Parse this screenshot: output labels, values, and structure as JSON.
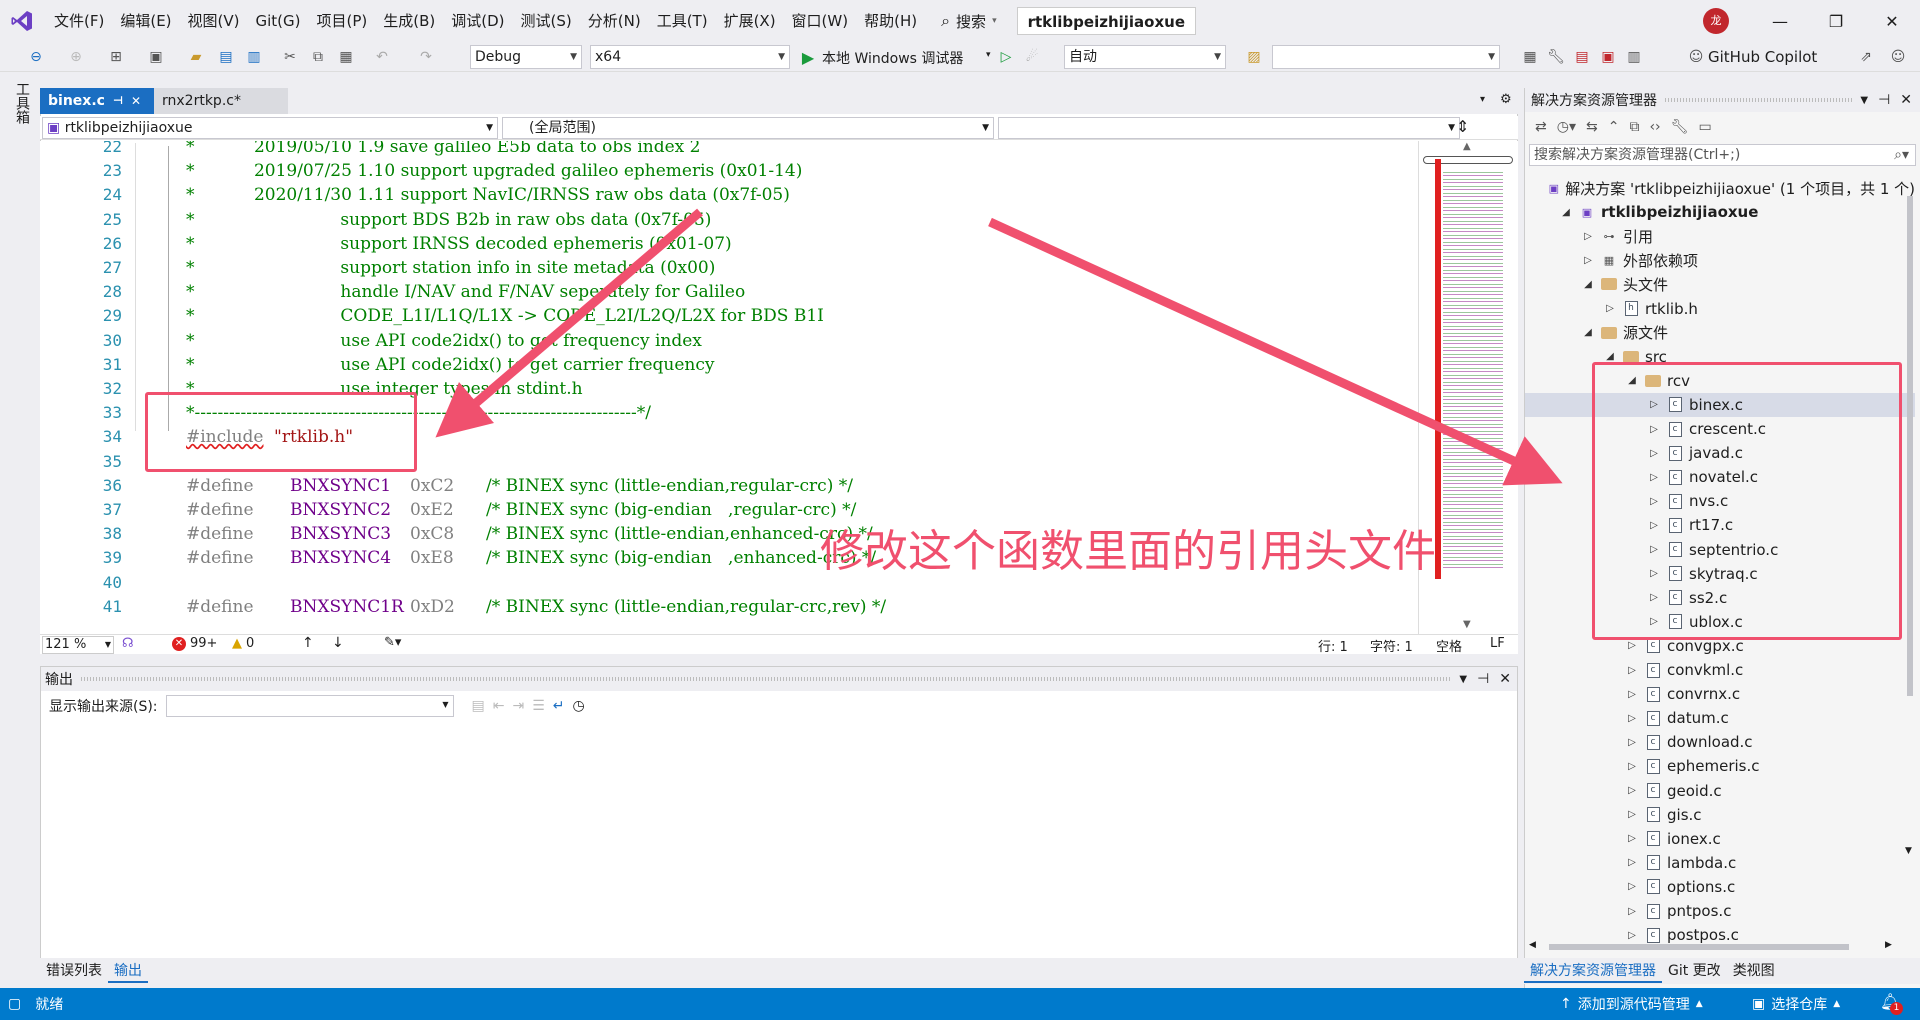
{
  "menubar": {
    "items": [
      "文件(F)",
      "编辑(E)",
      "视图(V)",
      "Git(G)",
      "项目(P)",
      "生成(B)",
      "调试(D)",
      "测试(S)",
      "分析(N)",
      "工具(T)",
      "扩展(X)",
      "窗口(W)",
      "帮助(H)"
    ],
    "search_label": "搜索",
    "solution_title": "rtklibpeizhijiaoxue",
    "avatar_text": "龙"
  },
  "toolbar": {
    "config": "Debug",
    "platform": "x64",
    "run_label": "本地 Windows 调试器",
    "auto_label": "自动",
    "copilot_label": "GitHub Copilot"
  },
  "left_strip": {
    "toolbox_label": "工具箱"
  },
  "editor": {
    "tabs": [
      {
        "label": "binex.c",
        "active": true
      },
      {
        "label": "rnx2rtkp.c*",
        "active": false
      }
    ],
    "nav": {
      "project": "rtklibpeizhijiaoxue",
      "scope": "(全局范围)",
      "member": ""
    },
    "lines": [
      {
        "num": "22",
        "text": "*           2019/05/10 1.9 save galileo E5b data to obs index 2"
      },
      {
        "num": "23",
        "text": "*           2019/07/25 1.10 support upgraded galileo ephemeris (0x01-14)"
      },
      {
        "num": "24",
        "text": "*           2020/11/30 1.11 support NavIC/IRNSS raw obs data (0x7f-05)"
      },
      {
        "num": "25",
        "text": "*                           support BDS B2b in raw obs data (0x7f-05)"
      },
      {
        "num": "26",
        "text": "*                           support IRNSS decoded ephemeris (0x01-07)"
      },
      {
        "num": "27",
        "text": "*                           support station info in site metadata (0x00)"
      },
      {
        "num": "28",
        "text": "*                           handle I/NAV and F/NAV seperately for Galileo"
      },
      {
        "num": "29",
        "text": "*                           CODE_L1I/L1Q/L1X -> CODE_L2I/L2Q/L2X for BDS B1I"
      },
      {
        "num": "30",
        "text": "*                           use API code2idx() to get frequency index"
      },
      {
        "num": "31",
        "text": "*                           use API code2idx() to get carrier frequency"
      },
      {
        "num": "32",
        "text": "*                           use integer types in stdint.h"
      },
      {
        "num": "33",
        "text": "*-----------------------------------------------------------------------------*/"
      },
      {
        "num": "34",
        "text": ""
      },
      {
        "num": "35",
        "text": ""
      },
      {
        "num": "36",
        "text": ""
      },
      {
        "num": "37",
        "text": ""
      },
      {
        "num": "38",
        "text": ""
      },
      {
        "num": "39",
        "text": ""
      },
      {
        "num": "40",
        "text": ""
      },
      {
        "num": "41",
        "text": ""
      }
    ],
    "include": {
      "directive": "#include",
      "file": "\"rtklib.h\""
    },
    "defines": [
      {
        "kw": "#define",
        "name": "BNXSYNC1",
        "val": "0xC2",
        "comment": "/* BINEX sync (little-endian,regular-crc) */"
      },
      {
        "kw": "#define",
        "name": "BNXSYNC2",
        "val": "0xE2",
        "comment": "/* BINEX sync (big-endian   ,regular-crc) */"
      },
      {
        "kw": "#define",
        "name": "BNXSYNC3",
        "val": "0xC8",
        "comment": "/* BINEX sync (little-endian,enhanced-crc) */"
      },
      {
        "kw": "#define",
        "name": "BNXSYNC4",
        "val": "0xE8",
        "comment": "/* BINEX sync (big-endian   ,enhanced-crc) */"
      },
      {
        "kw": "#define",
        "name": "BNXSYNC1R",
        "val": "0xD2",
        "comment": "/* BINEX sync (little-endian,regular-crc,rev) */"
      }
    ],
    "status": {
      "zoom": "121 %",
      "errors": "99+",
      "warnings": "0",
      "line": "行: 1",
      "col": "字符: 1",
      "ws": "空格",
      "eol": "LF"
    }
  },
  "output": {
    "title": "输出",
    "source_label": "显示输出来源(S):",
    "source_value": ""
  },
  "bottom_tabs": [
    "错误列表",
    "输出"
  ],
  "solution_explorer": {
    "title": "解决方案资源管理器",
    "search_placeholder": "搜索解决方案资源管理器(Ctrl+;)",
    "items": [
      {
        "label": "解决方案 'rtklibpeizhijiaoxue' (1 个项目，共 1 个)",
        "depth": 0,
        "kind": "solution",
        "exp": ""
      },
      {
        "label": "rtklibpeizhijiaoxue",
        "depth": 1,
        "kind": "project",
        "exp": "◢"
      },
      {
        "label": "引用",
        "depth": 2,
        "kind": "ref",
        "exp": "▷"
      },
      {
        "label": "外部依赖项",
        "depth": 2,
        "kind": "ext",
        "exp": "▷"
      },
      {
        "label": "头文件",
        "depth": 2,
        "kind": "folder",
        "exp": "◢"
      },
      {
        "label": "rtklib.h",
        "depth": 3,
        "kind": "h",
        "exp": "▷"
      },
      {
        "label": "源文件",
        "depth": 2,
        "kind": "folder",
        "exp": "◢"
      },
      {
        "label": "src",
        "depth": 3,
        "kind": "folder",
        "exp": "◢"
      },
      {
        "label": "rcv",
        "depth": 4,
        "kind": "folder",
        "exp": "◢"
      },
      {
        "label": "binex.c",
        "depth": 5,
        "kind": "c",
        "exp": "▷",
        "selected": true
      },
      {
        "label": "crescent.c",
        "depth": 5,
        "kind": "c",
        "exp": "▷"
      },
      {
        "label": "javad.c",
        "depth": 5,
        "kind": "c",
        "exp": "▷"
      },
      {
        "label": "novatel.c",
        "depth": 5,
        "kind": "c",
        "exp": "▷"
      },
      {
        "label": "nvs.c",
        "depth": 5,
        "kind": "c",
        "exp": "▷"
      },
      {
        "label": "rt17.c",
        "depth": 5,
        "kind": "c",
        "exp": "▷"
      },
      {
        "label": "septentrio.c",
        "depth": 5,
        "kind": "c",
        "exp": "▷"
      },
      {
        "label": "skytraq.c",
        "depth": 5,
        "kind": "c",
        "exp": "▷"
      },
      {
        "label": "ss2.c",
        "depth": 5,
        "kind": "c",
        "exp": "▷"
      },
      {
        "label": "ublox.c",
        "depth": 5,
        "kind": "c",
        "exp": "▷"
      },
      {
        "label": "convgpx.c",
        "depth": 4,
        "kind": "c",
        "exp": "▷"
      },
      {
        "label": "convkml.c",
        "depth": 4,
        "kind": "c",
        "exp": "▷"
      },
      {
        "label": "convrnx.c",
        "depth": 4,
        "kind": "c",
        "exp": "▷"
      },
      {
        "label": "datum.c",
        "depth": 4,
        "kind": "c",
        "exp": "▷"
      },
      {
        "label": "download.c",
        "depth": 4,
        "kind": "c",
        "exp": "▷"
      },
      {
        "label": "ephemeris.c",
        "depth": 4,
        "kind": "c",
        "exp": "▷"
      },
      {
        "label": "geoid.c",
        "depth": 4,
        "kind": "c",
        "exp": "▷"
      },
      {
        "label": "gis.c",
        "depth": 4,
        "kind": "c",
        "exp": "▷"
      },
      {
        "label": "ionex.c",
        "depth": 4,
        "kind": "c",
        "exp": "▷"
      },
      {
        "label": "lambda.c",
        "depth": 4,
        "kind": "c",
        "exp": "▷"
      },
      {
        "label": "options.c",
        "depth": 4,
        "kind": "c",
        "exp": "▷"
      },
      {
        "label": "pntpos.c",
        "depth": 4,
        "kind": "c",
        "exp": "▷"
      },
      {
        "label": "postpos.c",
        "depth": 4,
        "kind": "c",
        "exp": "▷"
      }
    ],
    "bottom_tabs": [
      "解决方案资源管理器",
      "Git 更改",
      "类视图"
    ]
  },
  "statusbar": {
    "ready": "就绪",
    "add_source": "添加到源代码管理",
    "select_repo": "选择仓库",
    "notify_count": "1"
  },
  "annotation": {
    "text": "修改这个函数里面的引用头文件",
    "color": "#f0506e"
  },
  "colors": {
    "accent": "#1b6ec2",
    "statusbar": "#007acc",
    "comment": "#008000",
    "macro": "#6f008a",
    "string": "#a31515"
  }
}
